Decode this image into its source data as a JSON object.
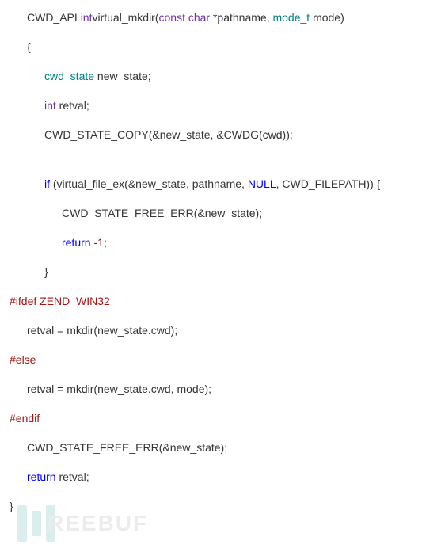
{
  "lines": [
    {
      "indent": 1,
      "segments": [
        {
          "cls": "normal",
          "t": "CWD_API "
        },
        {
          "cls": "kw-type",
          "t": "int"
        },
        {
          "cls": "normal",
          "t": "virtual_mkdir("
        },
        {
          "cls": "kw-const",
          "t": "const"
        },
        {
          "cls": "normal",
          "t": " "
        },
        {
          "cls": "kw-type",
          "t": "char"
        },
        {
          "cls": "normal",
          "t": " *pathname, "
        },
        {
          "cls": "kw-teal",
          "t": "mode_t"
        },
        {
          "cls": "normal",
          "t": " mode)"
        }
      ]
    },
    {
      "indent": 1,
      "segments": [
        {
          "cls": "normal",
          "t": "{"
        }
      ]
    },
    {
      "indent": 2,
      "segments": [
        {
          "cls": "kw-teal",
          "t": "cwd_state"
        },
        {
          "cls": "normal",
          "t": " new_state;"
        }
      ]
    },
    {
      "indent": 2,
      "segments": [
        {
          "cls": "kw-type",
          "t": "int"
        },
        {
          "cls": "normal",
          "t": " retval;"
        }
      ]
    },
    {
      "indent": 2,
      "segments": [
        {
          "cls": "normal",
          "t": "CWD_STATE_COPY(&new_state, &CWDG(cwd));"
        }
      ]
    },
    {
      "indent": 2,
      "segments": [],
      "spacer": true
    },
    {
      "indent": 2,
      "segments": [
        {
          "cls": "kw-control",
          "t": "if"
        },
        {
          "cls": "normal",
          "t": " (virtual_file_ex(&new_state, pathname, "
        },
        {
          "cls": "kw-blue",
          "t": "NULL"
        },
        {
          "cls": "normal",
          "t": ", CWD_FILEPATH)) {"
        }
      ]
    },
    {
      "indent": 3,
      "segments": [
        {
          "cls": "normal",
          "t": "CWD_STATE_FREE_ERR(&new_state);"
        }
      ]
    },
    {
      "indent": 3,
      "segments": [
        {
          "cls": "kw-control",
          "t": "return"
        },
        {
          "cls": "normal",
          "t": " -"
        },
        {
          "cls": "kw-num",
          "t": "1"
        },
        {
          "cls": "normal",
          "t": ";"
        }
      ]
    },
    {
      "indent": 2,
      "segments": [
        {
          "cls": "normal",
          "t": "}"
        }
      ]
    },
    {
      "indent": 0,
      "segments": [
        {
          "cls": "kw-preproc",
          "t": "#ifdef ZEND_WIN32"
        }
      ]
    },
    {
      "indent": 1,
      "segments": [
        {
          "cls": "normal",
          "t": "retval = mkdir(new_state.cwd);"
        }
      ]
    },
    {
      "indent": 0,
      "segments": [
        {
          "cls": "kw-preproc",
          "t": "#else"
        }
      ]
    },
    {
      "indent": 1,
      "segments": [
        {
          "cls": "normal",
          "t": "retval = mkdir(new_state.cwd, mode);"
        }
      ]
    },
    {
      "indent": 0,
      "segments": [
        {
          "cls": "kw-preproc",
          "t": "#endif"
        }
      ]
    },
    {
      "indent": 1,
      "segments": [
        {
          "cls": "normal",
          "t": "CWD_STATE_FREE_ERR(&new_state);"
        }
      ]
    },
    {
      "indent": 1,
      "segments": [
        {
          "cls": "kw-control",
          "t": "return"
        },
        {
          "cls": "normal",
          "t": " retval;"
        }
      ]
    },
    {
      "indent": 0,
      "segments": [
        {
          "cls": "normal",
          "t": "}"
        }
      ]
    }
  ],
  "watermark_text": "REEBUF"
}
